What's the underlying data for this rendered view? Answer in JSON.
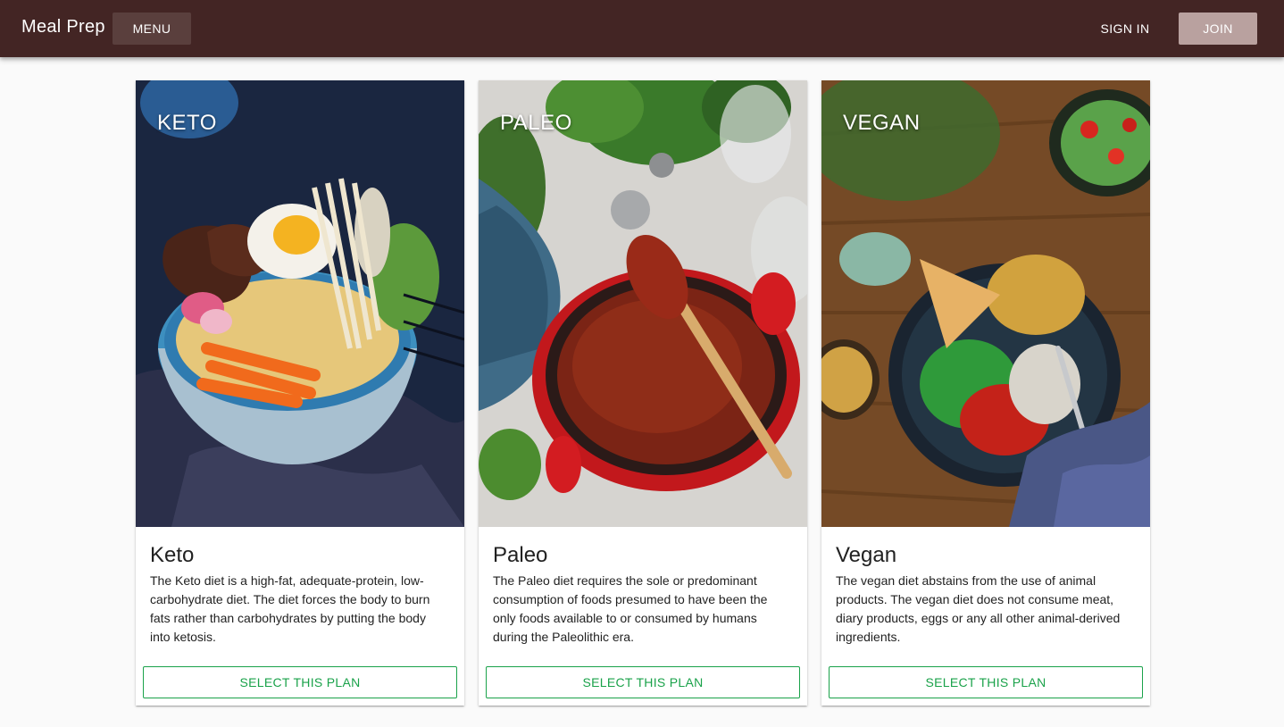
{
  "appbar": {
    "brand": "Meal Prep",
    "menu_label": "MENU",
    "signin_label": "SIGN IN",
    "join_label": "JOIN"
  },
  "colors": {
    "appbar": "#432524",
    "accent_green": "#1aa24a",
    "join_button": "#b9a19f"
  },
  "plans": [
    {
      "overlay": "KETO",
      "title": "Keto",
      "description": "The Keto diet is a high-fat, adequate-protein, low-carbohydrate diet. The diet forces the body to burn fats rather than carbohydrates by putting the body into ketosis.",
      "button": "SELECT THIS PLAN",
      "image": "keto-bowl-photo"
    },
    {
      "overlay": "PALEO",
      "title": "Paleo",
      "description": "The Paleo diet requires the sole or predominant consumption of foods presumed to have been the only foods available to or consumed by humans during the Paleolithic era.",
      "button": "SELECT THIS PLAN",
      "image": "paleo-stew-pot-photo"
    },
    {
      "overlay": "VEGAN",
      "title": "Vegan",
      "description": "The vegan diet abstains from the use of animal products. The vegan diet does not consume meat, diary products, eggs or any all other animal-derived ingredients.",
      "button": "SELECT THIS PLAN",
      "image": "vegan-salad-bowl-photo"
    }
  ]
}
